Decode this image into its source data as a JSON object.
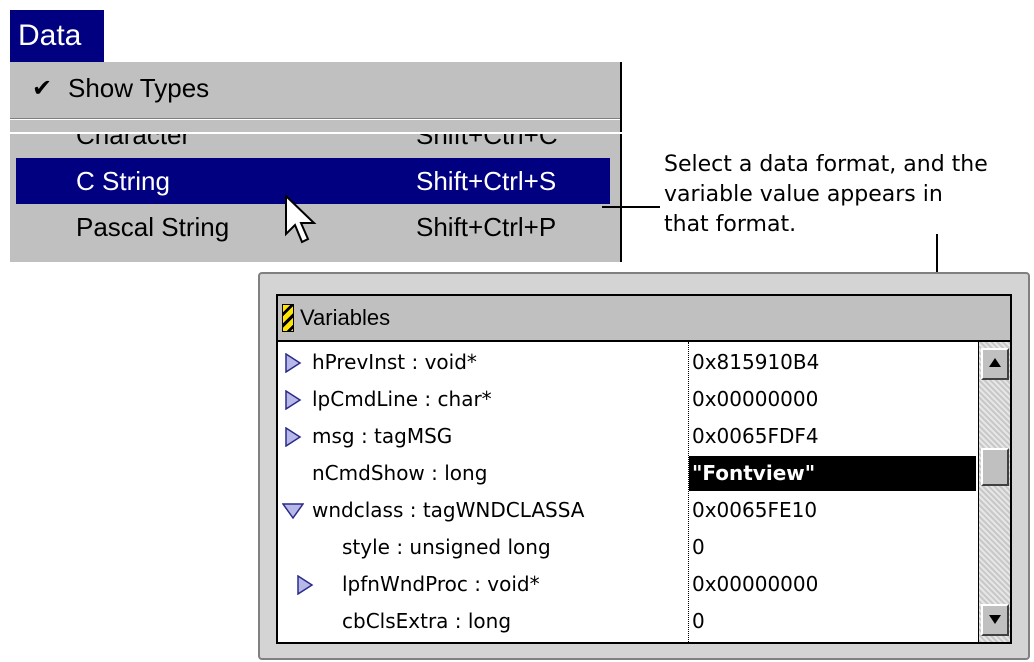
{
  "menu": {
    "title": "Data",
    "show_types": {
      "label": "Show Types",
      "checked": true
    },
    "items": [
      {
        "name": "Character",
        "shortcut": "Shift+Ctrl+C",
        "state": "clipped"
      },
      {
        "name": "C String",
        "shortcut": "Shift+Ctrl+S",
        "state": "selected"
      },
      {
        "name": "Pascal String",
        "shortcut": "Shift+Ctrl+P",
        "state": "normal"
      }
    ],
    "highlight_color": "#000080",
    "background_color": "#c0c0c0"
  },
  "annotation": {
    "text": "Select a data format, and the variable value appears in that format."
  },
  "variables_window": {
    "title": "Variables",
    "rows": [
      {
        "name": "hPrevInst : void*",
        "value": "0x815910B4",
        "disclosure": "collapsed",
        "indent": 0
      },
      {
        "name": "lpCmdLine : char*",
        "value": "0x00000000",
        "disclosure": "collapsed",
        "indent": 0
      },
      {
        "name": "msg : tagMSG",
        "value": "0x0065FDF4",
        "disclosure": "collapsed",
        "indent": 0
      },
      {
        "name": "nCmdShow : long",
        "value": "\"Fontview\"",
        "disclosure": "none",
        "indent": 0,
        "highlighted": true
      },
      {
        "name": "wndclass : tagWNDCLASSA",
        "value": "0x0065FE10",
        "disclosure": "expanded",
        "indent": 0
      },
      {
        "name": "style : unsigned long",
        "value": "0",
        "disclosure": "none",
        "indent": 1
      },
      {
        "name": "lpfnWndProc : void*",
        "value": "0x00000000",
        "disclosure": "collapsed",
        "indent": 1
      },
      {
        "name": "cbClsExtra : long",
        "value": "0",
        "disclosure": "none",
        "indent": 1
      }
    ],
    "icons": {
      "window_flag": "striped-flag-icon",
      "disclosure_collapsed": "triangle-right-icon",
      "disclosure_expanded": "triangle-down-icon",
      "scroll_up": "arrow-up-icon",
      "scroll_down": "arrow-down-icon"
    }
  }
}
